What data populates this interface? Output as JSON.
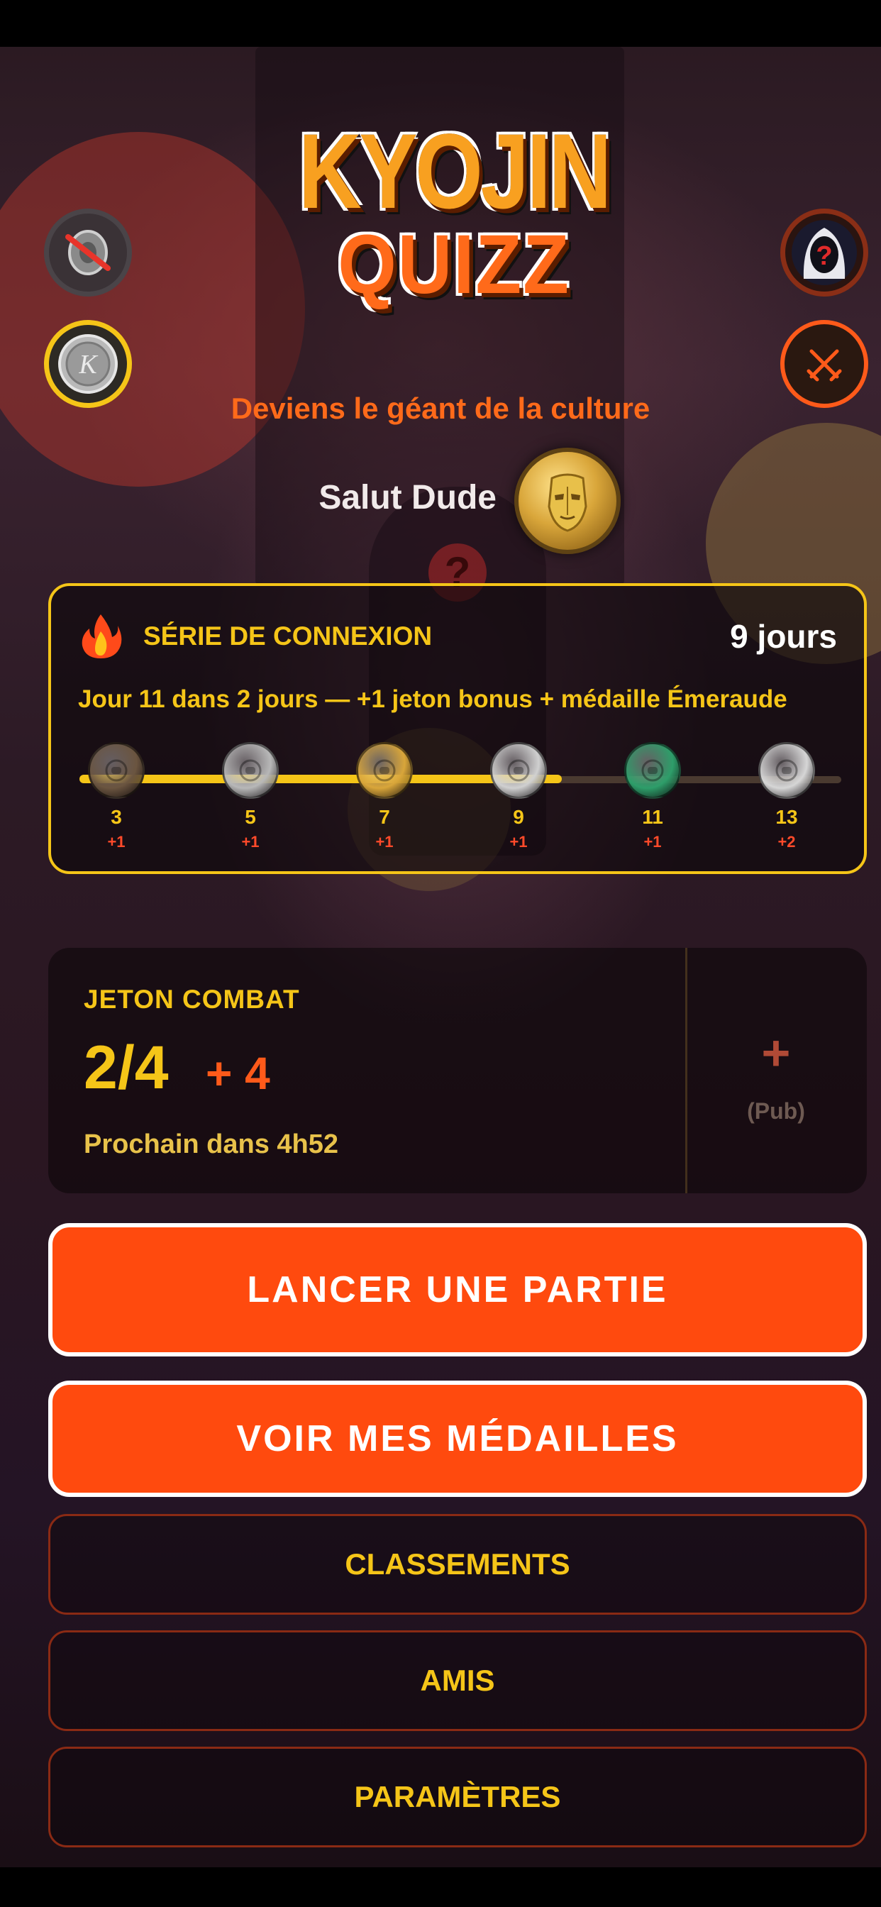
{
  "app": {
    "logo_line1": "KYOJIN",
    "logo_line2": "QUIZZ",
    "tagline": "Deviens le géant de la culture",
    "greeting": "Salut Dude"
  },
  "icons": {
    "sound": "speaker-muted-icon",
    "currency": "silver-coin-icon",
    "avatar": "hooded-mystery-avatar-icon",
    "battle": "crossed-swords-icon",
    "streak": "flame-icon",
    "profile": "gold-mask-medal-icon"
  },
  "streak": {
    "title": "SÉRIE DE CONNEXION",
    "days": "9 jours",
    "subtitle": "Jour 11 dans 2 jours — +1 jeton bonus + médaille Émeraude",
    "progress_reached_day": 9,
    "milestones": [
      {
        "day": "3",
        "bonus": "+1",
        "color": "#6b5540",
        "reached": true
      },
      {
        "day": "5",
        "bonus": "+1",
        "color": "#b8b8b8",
        "reached": true
      },
      {
        "day": "7",
        "bonus": "+1",
        "color": "#d9a63a",
        "reached": true
      },
      {
        "day": "9",
        "bonus": "+1",
        "color": "#d0d0d0",
        "reached": true
      },
      {
        "day": "11",
        "bonus": "+1",
        "color": "#2e9e6a",
        "reached": false
      },
      {
        "day": "13",
        "bonus": "+2",
        "color": "#d6d6d6",
        "reached": false
      }
    ]
  },
  "token": {
    "label": "JETON COMBAT",
    "count": "2/4",
    "bonus": "+ 4",
    "next": "Prochain dans 4h52",
    "ad_plus": "+",
    "ad_label": "(Pub)"
  },
  "buttons": {
    "play": "LANCER UNE PARTIE",
    "medals": "VOIR MES MÉDAILLES",
    "rankings": "CLASSEMENTS",
    "friends": "AMIS",
    "settings": "PARAMÈTRES"
  },
  "colors": {
    "accent_orange": "#ff4a0e",
    "accent_yellow": "#f5c518",
    "tagline": "#ff6a1a"
  }
}
